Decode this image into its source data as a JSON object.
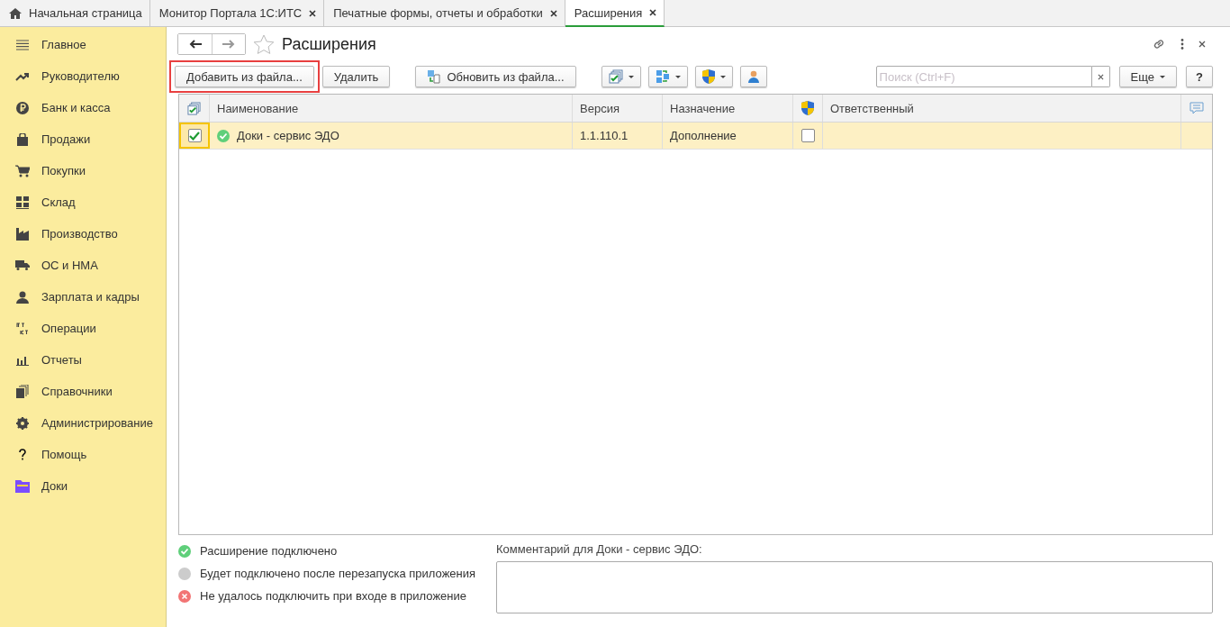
{
  "tabs": [
    {
      "label": "Начальная страница",
      "kind": "home",
      "selected": false
    },
    {
      "label": "Монитор Портала 1С:ИТС",
      "kind": "closable",
      "selected": false
    },
    {
      "label": "Печатные формы, отчеты и обработки",
      "kind": "closable",
      "selected": false
    },
    {
      "label": "Расширения",
      "kind": "closable",
      "selected": true
    }
  ],
  "sidebar": {
    "items": [
      {
        "label": "Главное"
      },
      {
        "label": "Руководителю"
      },
      {
        "label": "Банк и касса"
      },
      {
        "label": "Продажи"
      },
      {
        "label": "Покупки"
      },
      {
        "label": "Склад"
      },
      {
        "label": "Производство"
      },
      {
        "label": "ОС и НМА"
      },
      {
        "label": "Зарплата и кадры"
      },
      {
        "label": "Операции"
      },
      {
        "label": "Отчеты"
      },
      {
        "label": "Справочники"
      },
      {
        "label": "Администрирование"
      },
      {
        "label": "Помощь"
      },
      {
        "label": "Доки"
      }
    ]
  },
  "form": {
    "title": "Расширения",
    "favorite": false,
    "toolbar": [
      {
        "kind": "text",
        "label": "Добавить из файла...",
        "highlighted": true
      },
      {
        "kind": "text",
        "label": "Удалить",
        "highlighted": false
      },
      {
        "kind": "text",
        "label": "Обновить из файла...",
        "highlighted": false
      },
      {
        "kind": "menu",
        "highlighted": false
      },
      {
        "kind": "menu",
        "highlighted": false
      },
      {
        "kind": "menu",
        "highlighted": false
      },
      {
        "kind": "icon",
        "highlighted": false
      }
    ],
    "search": {
      "placeholder": "Поиск (Ctrl+F)"
    },
    "more_button": "Еще",
    "help_button": "?",
    "table": {
      "columns": [
        "Наименование",
        "Версия",
        "Назначение",
        "Ответственный"
      ],
      "rows": [
        {
          "selected": true,
          "active": true,
          "kind": "ok",
          "name": "Доки - сервис ЭДО",
          "version": "1.1.110.1",
          "purpose": "Дополнение",
          "safe_mode": false
        }
      ]
    },
    "legend": [
      {
        "kind": "ok",
        "label": "Расширение подключено"
      },
      {
        "kind": "pending",
        "label": "Будет подключено после перезапуска приложения"
      },
      {
        "kind": "error",
        "label": "Не удалось подключить при входе в приложение"
      }
    ],
    "comment": {
      "label": "Комментарий для Доки - сервис ЭДО:"
    }
  }
}
